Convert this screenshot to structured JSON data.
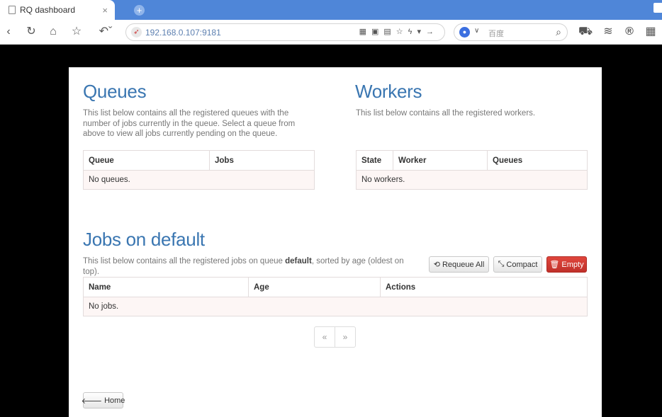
{
  "browser": {
    "tab_title": "RQ dashboard",
    "tab_close": "×",
    "new_tab": "+",
    "url": "192.168.0.107:9181",
    "search_placeholder": "百度"
  },
  "queues": {
    "title": "Queues",
    "description": "This list below contains all the registered queues with the number of jobs currently in the queue. Select a queue from above to view all jobs currently pending on the queue.",
    "columns": [
      "Queue",
      "Jobs"
    ],
    "empty": "No queues."
  },
  "workers": {
    "title": "Workers",
    "description": "This list below contains all the registered workers.",
    "columns": [
      "State",
      "Worker",
      "Queues"
    ],
    "empty": "No workers."
  },
  "jobs": {
    "title": "Jobs on default",
    "desc_before": "This list below contains all the registered jobs on queue ",
    "desc_queue": "default",
    "desc_after": ", sorted by age (oldest on top).",
    "columns": [
      "Name",
      "Age",
      "Actions"
    ],
    "empty": "No jobs.",
    "requeue_label": "Requeue All",
    "compact_label": "Compact",
    "empty_label": "Empty",
    "pager_prev": "«",
    "pager_next": "»"
  },
  "home_label": "Home",
  "colors": {
    "heading": "#3a76b1",
    "danger": "#d9534f",
    "tabbar": "#4f86d8"
  }
}
